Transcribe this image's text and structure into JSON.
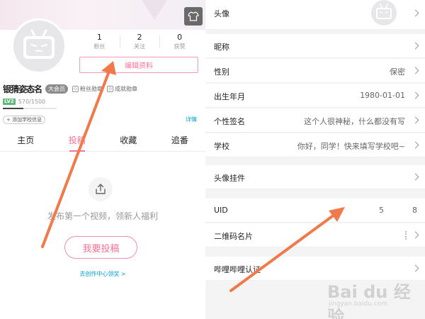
{
  "profile": {
    "stats": [
      {
        "value": "1",
        "label": "粉丝"
      },
      {
        "value": "2",
        "label": "关注"
      },
      {
        "value": "0",
        "label": "获赞"
      }
    ],
    "edit_label": "编辑资料",
    "username": "银猜姿态名",
    "vip_badge": "大会员",
    "medal_fans": "粉丝勋章",
    "medal_achieve": "成就勋章",
    "level": "LV2",
    "exp_text": "570/1500",
    "exp_fraction": 0.38,
    "add_school": "+ 添加学校信息",
    "detail_link": "详情",
    "tabs": [
      {
        "label": "主页"
      },
      {
        "label": "投稿"
      },
      {
        "label": "收藏"
      },
      {
        "label": "追番"
      }
    ],
    "empty_text": "发布第一个视频，领新人福利",
    "post_button": "我要投稿",
    "creator_link": "去创作中心领奖 >"
  },
  "settings": {
    "avatar_label": "头像",
    "nickname_label": "昵称",
    "gender_label": "性别",
    "gender_value": "保密",
    "birth_label": "出生年月",
    "birth_value": "1980-01-01",
    "signature_label": "个性签名",
    "signature_value": "这个人很神秘，什么都没有写",
    "school_label": "学校",
    "school_value": "你好，同学！快来填写学校吧~",
    "pendant_label": "头像挂件",
    "uid_label": "UID",
    "uid_value_a": "5",
    "uid_value_b": "8",
    "qr_label": "二维码名片",
    "verify_label": "哔哩哔哩认证"
  },
  "watermark": {
    "logo": "Bai du 经验",
    "sub": "jingyan.baidu.com"
  },
  "colors": {
    "accent": "#fb7299",
    "link": "#00a1d6",
    "arrow": "#f07a4a"
  }
}
